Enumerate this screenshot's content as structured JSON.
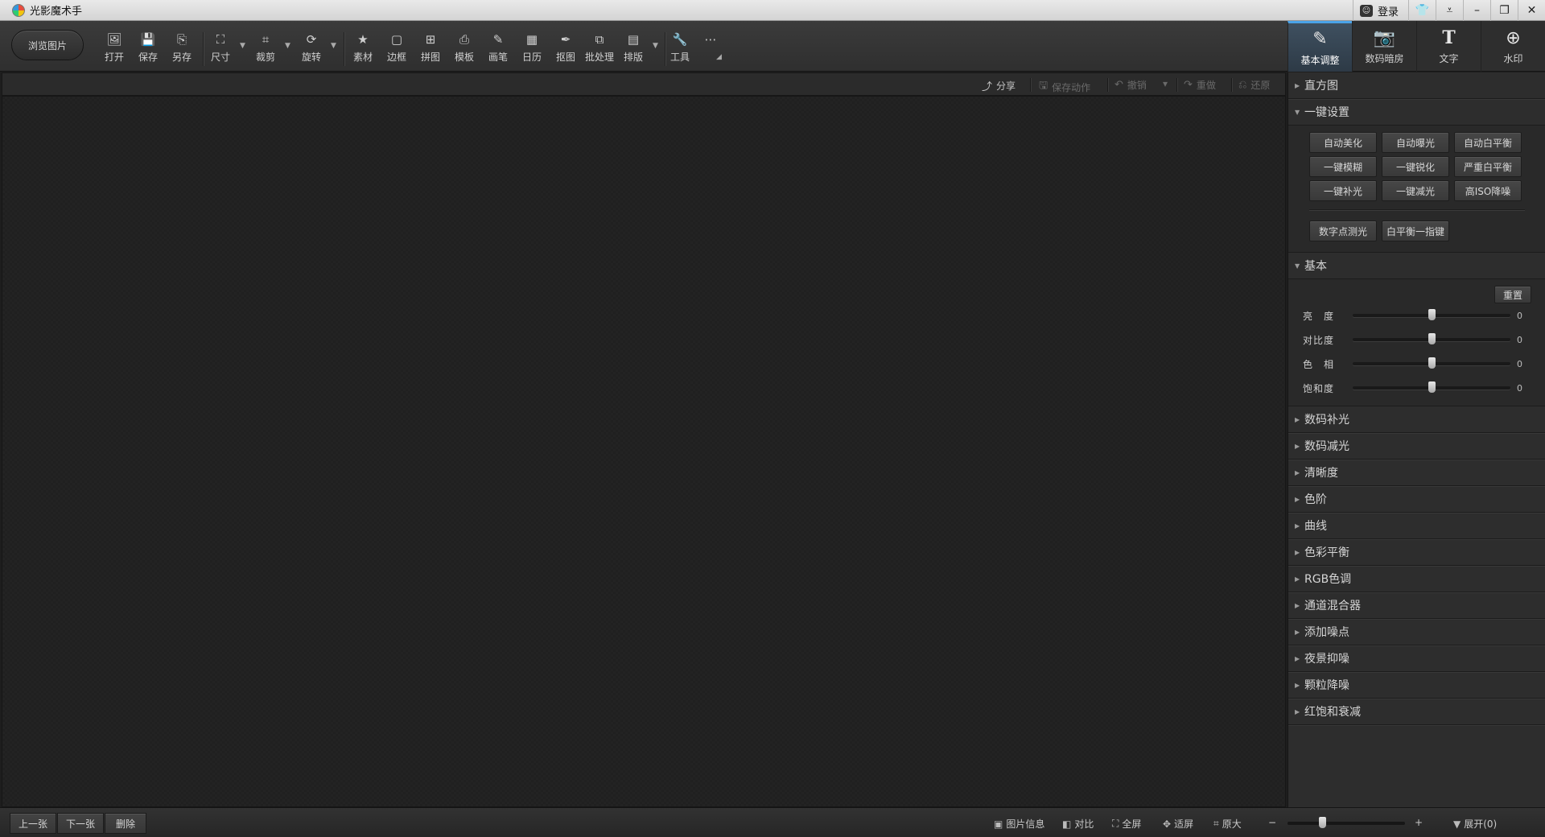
{
  "window": {
    "app_title": "光影魔术手",
    "login_label": "登录",
    "controls": [
      "skin-icon",
      "menu-icon",
      "minimize-icon",
      "restore-icon",
      "close-icon"
    ]
  },
  "toolbar": {
    "browse_label": "浏览图片",
    "tools": [
      {
        "label": "打开",
        "icon": "open-icon"
      },
      {
        "label": "保存",
        "icon": "save-icon"
      },
      {
        "label": "另存",
        "icon": "save-as-icon"
      },
      {
        "label": "尺寸",
        "icon": "resize-icon"
      },
      {
        "label": "裁剪",
        "icon": "crop-icon"
      },
      {
        "label": "旋转",
        "icon": "rotate-icon"
      },
      {
        "label": "素材",
        "icon": "material-icon"
      },
      {
        "label": "边框",
        "icon": "border-icon"
      },
      {
        "label": "拼图",
        "icon": "collage-icon"
      },
      {
        "label": "模板",
        "icon": "template-icon"
      },
      {
        "label": "画笔",
        "icon": "brush-icon"
      },
      {
        "label": "日历",
        "icon": "calendar-icon"
      },
      {
        "label": "抠图",
        "icon": "cutout-icon"
      },
      {
        "label": "批处理",
        "icon": "batch-icon"
      },
      {
        "label": "排版",
        "icon": "layout-icon"
      },
      {
        "label": "工具",
        "icon": "tools-icon"
      },
      {
        "label": "",
        "icon": "more-icon"
      }
    ]
  },
  "tabs": [
    {
      "label": "基本调整",
      "icon": "basic-adjust-icon",
      "active": true
    },
    {
      "label": "数码暗房",
      "icon": "darkroom-icon",
      "active": false
    },
    {
      "label": "文字",
      "icon": "text-icon",
      "active": false
    },
    {
      "label": "水印",
      "icon": "watermark-icon",
      "active": false
    }
  ],
  "subbar": {
    "share": "分享",
    "save_action": "保存动作",
    "undo": "撤销",
    "redo": "重做",
    "restore": "还原"
  },
  "panel": {
    "histogram": "直方图",
    "one_click": {
      "title": "一键设置",
      "buttons": [
        "自动美化",
        "自动曝光",
        "自动白平衡",
        "一键模糊",
        "一键锐化",
        "严重白平衡",
        "一键补光",
        "一键减光",
        "高ISO降噪"
      ],
      "extra_buttons": [
        "数字点测光",
        "白平衡一指键"
      ]
    },
    "basic": {
      "title": "基本",
      "reset": "重置",
      "sliders": [
        {
          "label": "亮　度",
          "value": "0",
          "position": 0.5
        },
        {
          "label": "对比度",
          "value": "0",
          "position": 0.5
        },
        {
          "label": "色　相",
          "value": "0",
          "position": 0.5
        },
        {
          "label": "饱和度",
          "value": "0",
          "position": 0.5
        }
      ]
    },
    "sections": [
      "数码补光",
      "数码减光",
      "清晰度",
      "色阶",
      "曲线",
      "色彩平衡",
      "RGB色调",
      "通道混合器",
      "添加噪点",
      "夜景抑噪",
      "颗粒降噪",
      "红饱和衰减"
    ]
  },
  "statusbar": {
    "prev": "上一张",
    "next": "下一张",
    "delete": "删除",
    "info": "图片信息",
    "compare": "对比",
    "fullscreen": "全屏",
    "fit": "适屏",
    "original": "原大",
    "zoom_minus": "−",
    "zoom_plus": "+",
    "zoom_level": 0.3,
    "expand": "展开(0)"
  }
}
